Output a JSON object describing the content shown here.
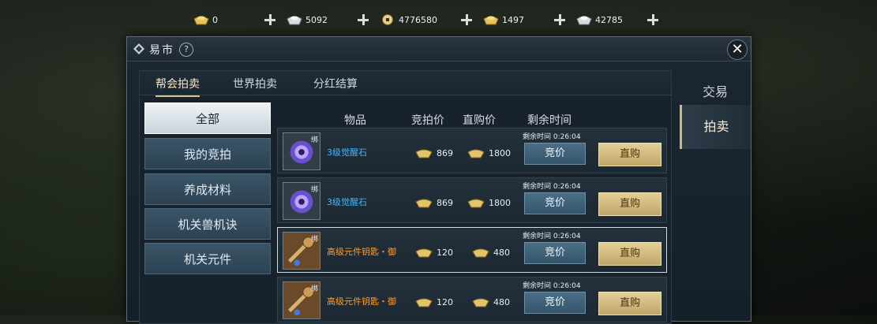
{
  "currencies": [
    {
      "icon": "gold-ingot-icon",
      "value": "0"
    },
    {
      "icon": "silver-ingot-icon",
      "value": "5092"
    },
    {
      "icon": "copper-coin-icon",
      "value": "4776580"
    },
    {
      "icon": "gold-ingot-icon",
      "value": "1497"
    },
    {
      "icon": "silver-ingot-icon",
      "value": "42785"
    }
  ],
  "window": {
    "title": "易市",
    "help": "?",
    "close": "✕"
  },
  "subtabs": [
    "帮会拍卖",
    "世界拍卖",
    "分红结算"
  ],
  "side_tabs": [
    "交易",
    "拍卖"
  ],
  "categories": [
    "全部",
    "我的竞拍",
    "养成材料",
    "机关兽机诀",
    "机关元件"
  ],
  "headers": {
    "item": "物品",
    "bid_price": "竞拍价",
    "buy_price": "直购价",
    "remaining": "剩余时间"
  },
  "rows": [
    {
      "name": "3级觉醒石",
      "bound": "绑",
      "bid": "869",
      "buy": "1800",
      "remaining": "剩余时间 0:26:04",
      "bid_btn": "竞价",
      "buy_btn": "直购"
    },
    {
      "name": "3级觉醒石",
      "bound": "绑",
      "bid": "869",
      "buy": "1800",
      "remaining": "剩余时间 0:26:04",
      "bid_btn": "竞价",
      "buy_btn": "直购"
    },
    {
      "name": "高级元件钥匙・御",
      "bound": "绑",
      "bid": "120",
      "buy": "480",
      "remaining": "剩余时间 0:26:04",
      "bid_btn": "竞价",
      "buy_btn": "直购"
    },
    {
      "name": "高级元件钥匙・御",
      "bound": "绑",
      "bid": "120",
      "buy": "480",
      "remaining": "剩余时间 0:26:04",
      "bid_btn": "竞价",
      "buy_btn": "直购"
    }
  ],
  "colors": {
    "accent_gold": "#d9c48e",
    "item_blue": "#45b5ff",
    "item_orange": "#ff9b2f"
  }
}
